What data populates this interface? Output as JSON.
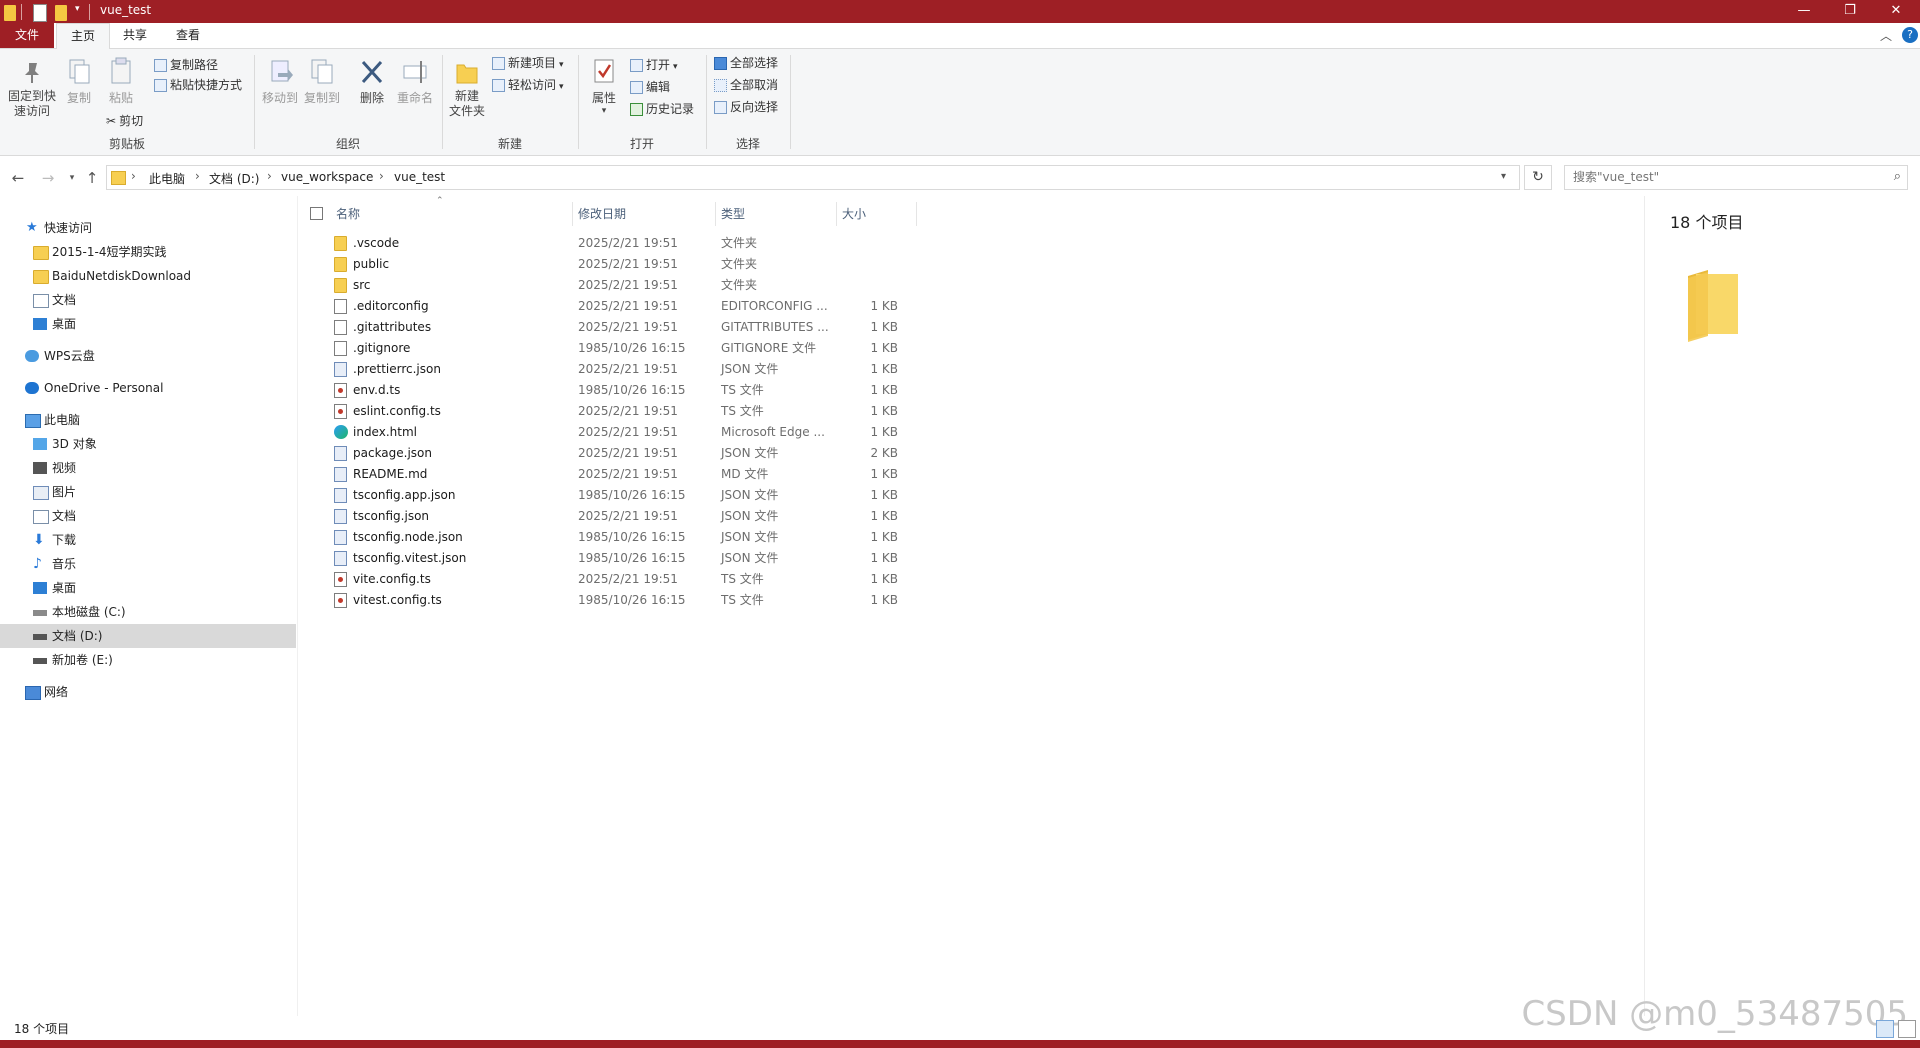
{
  "window": {
    "title": "vue_test",
    "minimize": "—",
    "maximize": "❐",
    "close": "✕"
  },
  "ribbon_tabs": {
    "file": "文件",
    "home": "主页",
    "share": "共享",
    "view": "查看"
  },
  "ribbon": {
    "clipboard": {
      "label": "剪贴板",
      "pin": "固定到快\n速访问",
      "copy": "复制",
      "paste": "粘贴",
      "copy_path": "复制路径",
      "paste_shortcut": "粘贴快捷方式",
      "cut": "剪切"
    },
    "organize": {
      "label": "组织",
      "move_to": "移动到",
      "copy_to": "复制到",
      "delete": "删除",
      "rename": "重命名"
    },
    "new": {
      "label": "新建",
      "new_folder": "新建\n文件夹",
      "new_item": "新建项目",
      "easy_access": "轻松访问"
    },
    "open": {
      "label": "打开",
      "properties": "属性",
      "open": "打开",
      "edit": "编辑",
      "history": "历史记录"
    },
    "select": {
      "label": "选择",
      "select_all": "全部选择",
      "select_none": "全部取消",
      "invert": "反向选择"
    }
  },
  "address": {
    "crumbs": [
      "此电脑",
      "文档 (D:)",
      "vue_workspace",
      "vue_test"
    ],
    "search_placeholder": "搜索\"vue_test\""
  },
  "nav": {
    "quick_access": "快速访问",
    "quick_items": [
      "2015-1-4短学期实践",
      "BaiduNetdiskDownload",
      "文档",
      "桌面"
    ],
    "wps": "WPS云盘",
    "onedrive": "OneDrive - Personal",
    "this_pc": "此电脑",
    "pc_items": [
      "3D 对象",
      "视频",
      "图片",
      "文档",
      "下载",
      "音乐",
      "桌面",
      "本地磁盘 (C:)",
      "文档 (D:)",
      "新加卷 (E:)"
    ],
    "network": "网络"
  },
  "columns": {
    "name": "名称",
    "date": "修改日期",
    "type": "类型",
    "size": "大小"
  },
  "files": [
    {
      "name": ".vscode",
      "date": "2025/2/21 19:51",
      "type": "文件夹",
      "size": "",
      "icon": "folder"
    },
    {
      "name": "public",
      "date": "2025/2/21 19:51",
      "type": "文件夹",
      "size": "",
      "icon": "folder"
    },
    {
      "name": "src",
      "date": "2025/2/21 19:51",
      "type": "文件夹",
      "size": "",
      "icon": "folder"
    },
    {
      "name": ".editorconfig",
      "date": "2025/2/21 19:51",
      "type": "EDITORCONFIG ...",
      "size": "1 KB",
      "icon": "doc"
    },
    {
      "name": ".gitattributes",
      "date": "2025/2/21 19:51",
      "type": "GITATTRIBUTES ...",
      "size": "1 KB",
      "icon": "doc"
    },
    {
      "name": ".gitignore",
      "date": "1985/10/26 16:15",
      "type": "GITIGNORE 文件",
      "size": "1 KB",
      "icon": "doc"
    },
    {
      "name": ".prettierrc.json",
      "date": "2025/2/21 19:51",
      "type": "JSON 文件",
      "size": "1 KB",
      "icon": "json"
    },
    {
      "name": "env.d.ts",
      "date": "1985/10/26 16:15",
      "type": "TS 文件",
      "size": "1 KB",
      "icon": "ts"
    },
    {
      "name": "eslint.config.ts",
      "date": "2025/2/21 19:51",
      "type": "TS 文件",
      "size": "1 KB",
      "icon": "ts"
    },
    {
      "name": "index.html",
      "date": "2025/2/21 19:51",
      "type": "Microsoft Edge ...",
      "size": "1 KB",
      "icon": "edge"
    },
    {
      "name": "package.json",
      "date": "2025/2/21 19:51",
      "type": "JSON 文件",
      "size": "2 KB",
      "icon": "json"
    },
    {
      "name": "README.md",
      "date": "2025/2/21 19:51",
      "type": "MD 文件",
      "size": "1 KB",
      "icon": "json"
    },
    {
      "name": "tsconfig.app.json",
      "date": "1985/10/26 16:15",
      "type": "JSON 文件",
      "size": "1 KB",
      "icon": "json"
    },
    {
      "name": "tsconfig.json",
      "date": "2025/2/21 19:51",
      "type": "JSON 文件",
      "size": "1 KB",
      "icon": "json"
    },
    {
      "name": "tsconfig.node.json",
      "date": "1985/10/26 16:15",
      "type": "JSON 文件",
      "size": "1 KB",
      "icon": "json"
    },
    {
      "name": "tsconfig.vitest.json",
      "date": "1985/10/26 16:15",
      "type": "JSON 文件",
      "size": "1 KB",
      "icon": "json"
    },
    {
      "name": "vite.config.ts",
      "date": "2025/2/21 19:51",
      "type": "TS 文件",
      "size": "1 KB",
      "icon": "ts"
    },
    {
      "name": "vitest.config.ts",
      "date": "1985/10/26 16:15",
      "type": "TS 文件",
      "size": "1 KB",
      "icon": "ts"
    }
  ],
  "details": {
    "count": "18 个项目"
  },
  "status": {
    "count": "18 个项目"
  },
  "watermark": "CSDN @m0_53487505",
  "colors": {
    "titlebar": "#9e1f25",
    "folder": "#f7cf52",
    "selected_nav": "#d9d9d9"
  }
}
